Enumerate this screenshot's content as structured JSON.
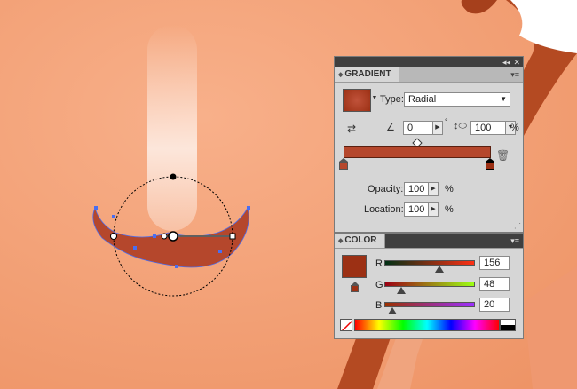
{
  "gradient_panel": {
    "tab_label": "GRADIENT",
    "type_label": "Type:",
    "type_value": "Radial",
    "angle_value": "0",
    "aspect_value": "100",
    "aspect_unit": "%",
    "opacity_label": "Opacity:",
    "opacity_value": "100",
    "opacity_unit": "%",
    "location_label": "Location:",
    "location_value": "100",
    "location_unit": "%",
    "swatch_color": "#9c3014",
    "bar_color": "#b5472c"
  },
  "color_panel": {
    "tab_label": "COLOR",
    "r_label": "R",
    "g_label": "G",
    "b_label": "B",
    "r_value": "156",
    "g_value": "48",
    "b_value": "20",
    "r_level": 0.61,
    "g_level": 0.19,
    "b_level": 0.08,
    "swatch_color": "#9c3014"
  },
  "colors": {
    "background": "#f3a27a",
    "shape_fill": "#b5472c",
    "annotation": "#e5289b",
    "selection": "#4a6ef0"
  },
  "icons": [
    "collapse-icon",
    "close-icon",
    "panel-menu-icon",
    "reverse-gradient-icon",
    "angle-icon",
    "aspect-ratio-icon",
    "trash-icon",
    "out-of-gamut-icon",
    "none-swatch-icon"
  ]
}
